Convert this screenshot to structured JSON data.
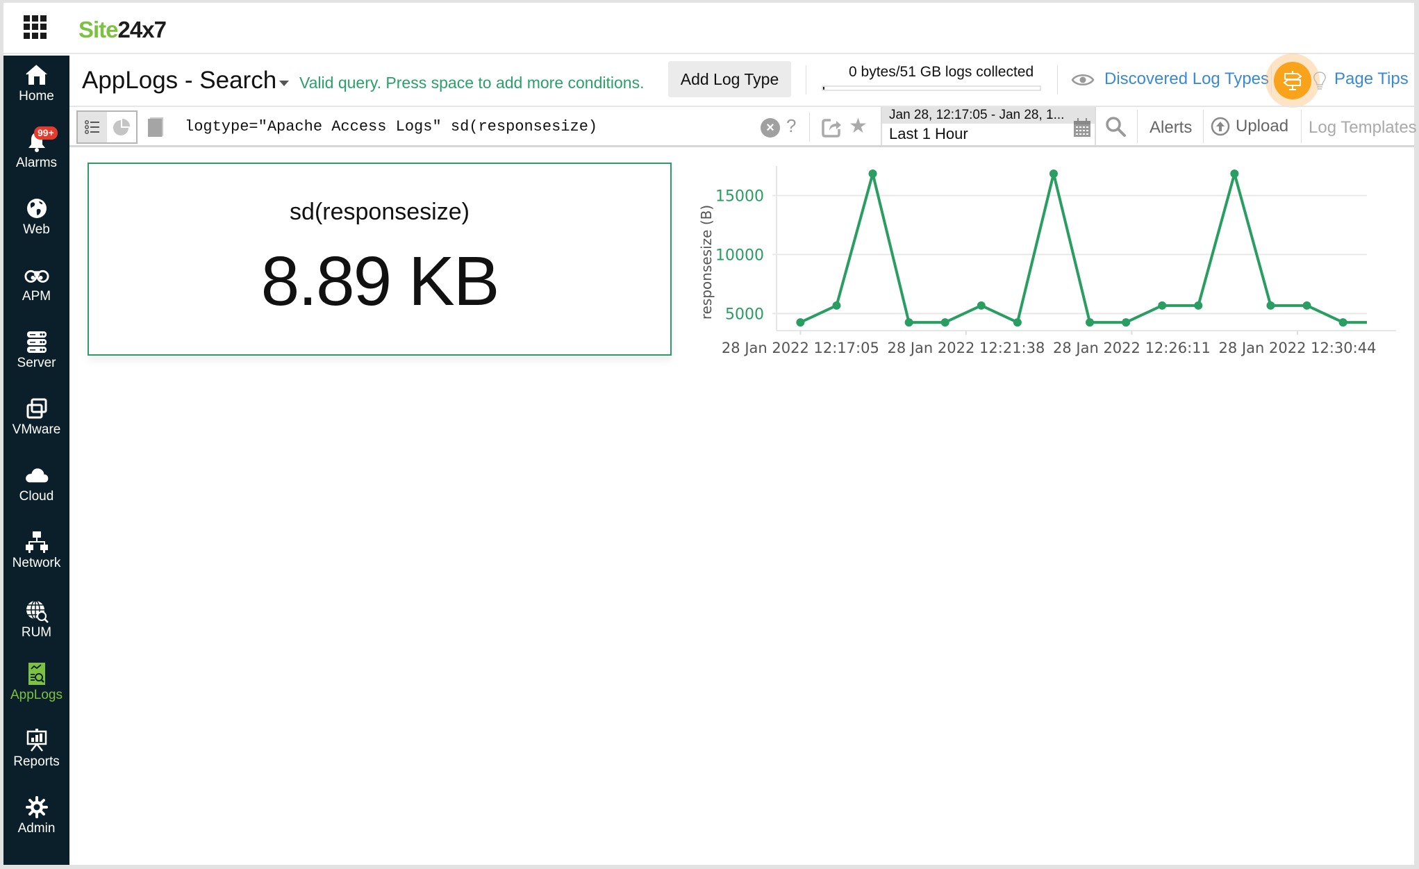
{
  "topbar": {
    "apps_icon": "grid-apps-icon",
    "logo_part1": "Site",
    "logo_part2": "24x7",
    "brand_color": "#7dc142"
  },
  "sidebar": {
    "items": [
      {
        "label": "Home",
        "icon": "home-icon"
      },
      {
        "label": "Alarms",
        "icon": "bell-icon",
        "badge": "99+"
      },
      {
        "label": "Web",
        "icon": "globe-icon"
      },
      {
        "label": "APM",
        "icon": "binoculars-icon"
      },
      {
        "label": "Server",
        "icon": "server-icon"
      },
      {
        "label": "VMware",
        "icon": "vmware-icon"
      },
      {
        "label": "Cloud",
        "icon": "cloud-icon"
      },
      {
        "label": "Network",
        "icon": "network-icon"
      },
      {
        "label": "RUM",
        "icon": "rum-icon"
      },
      {
        "label": "AppLogs",
        "icon": "applogs-icon",
        "active": true
      },
      {
        "label": "Reports",
        "icon": "reports-icon"
      },
      {
        "label": "Admin",
        "icon": "gear-icon"
      }
    ]
  },
  "header": {
    "title": "AppLogs - Search",
    "valid_message": "Valid query. Press space to add more conditions.",
    "add_log_type": "Add Log Type",
    "usage_text": "0 bytes/51 GB logs collected",
    "usage_fraction": 0.0,
    "discovered_link": "Discovered Log Types",
    "page_tips": "Page Tips"
  },
  "querybar": {
    "query": "logtype=\"Apache Access Logs\" sd(responsesize)",
    "help": "?",
    "clear": "×",
    "date_range": "Jan 28, 12:17:05 - Jan 28, 1...",
    "period": "Last 1 Hour",
    "alerts": "Alerts",
    "upload": "Upload",
    "log_templates": "Log Templates"
  },
  "card": {
    "title": "sd(responsesize)",
    "value": "8.89 KB"
  },
  "chart_data": {
    "type": "line",
    "title": "",
    "xlabel": "",
    "ylabel": "responsesize (B)",
    "ylim": [
      3550,
      17500
    ],
    "yticks": [
      5000,
      10000,
      15000
    ],
    "grid": true,
    "legend": "none",
    "color": "#2a9d62",
    "x_tick_labels": [
      "28 Jan 2022 12:17:05",
      "28 Jan 2022 12:21:38",
      "28 Jan 2022 12:26:11",
      "28 Jan 2022 12:30:44"
    ],
    "x_tick_positions": [
      0,
      4.58,
      9.16,
      13.74
    ],
    "x": [
      0,
      1,
      2,
      3,
      4,
      5,
      6,
      7,
      8,
      9,
      10,
      11,
      12,
      13,
      14,
      15,
      16
    ],
    "series": [
      {
        "name": "responsesize",
        "values": [
          4250,
          5680,
          16850,
          4250,
          4250,
          5680,
          4250,
          16850,
          4250,
          4250,
          5680,
          5680,
          16850,
          5680,
          5680,
          4250,
          4250
        ]
      }
    ],
    "x_min": -0.66,
    "x_visible_max": 15.66
  }
}
